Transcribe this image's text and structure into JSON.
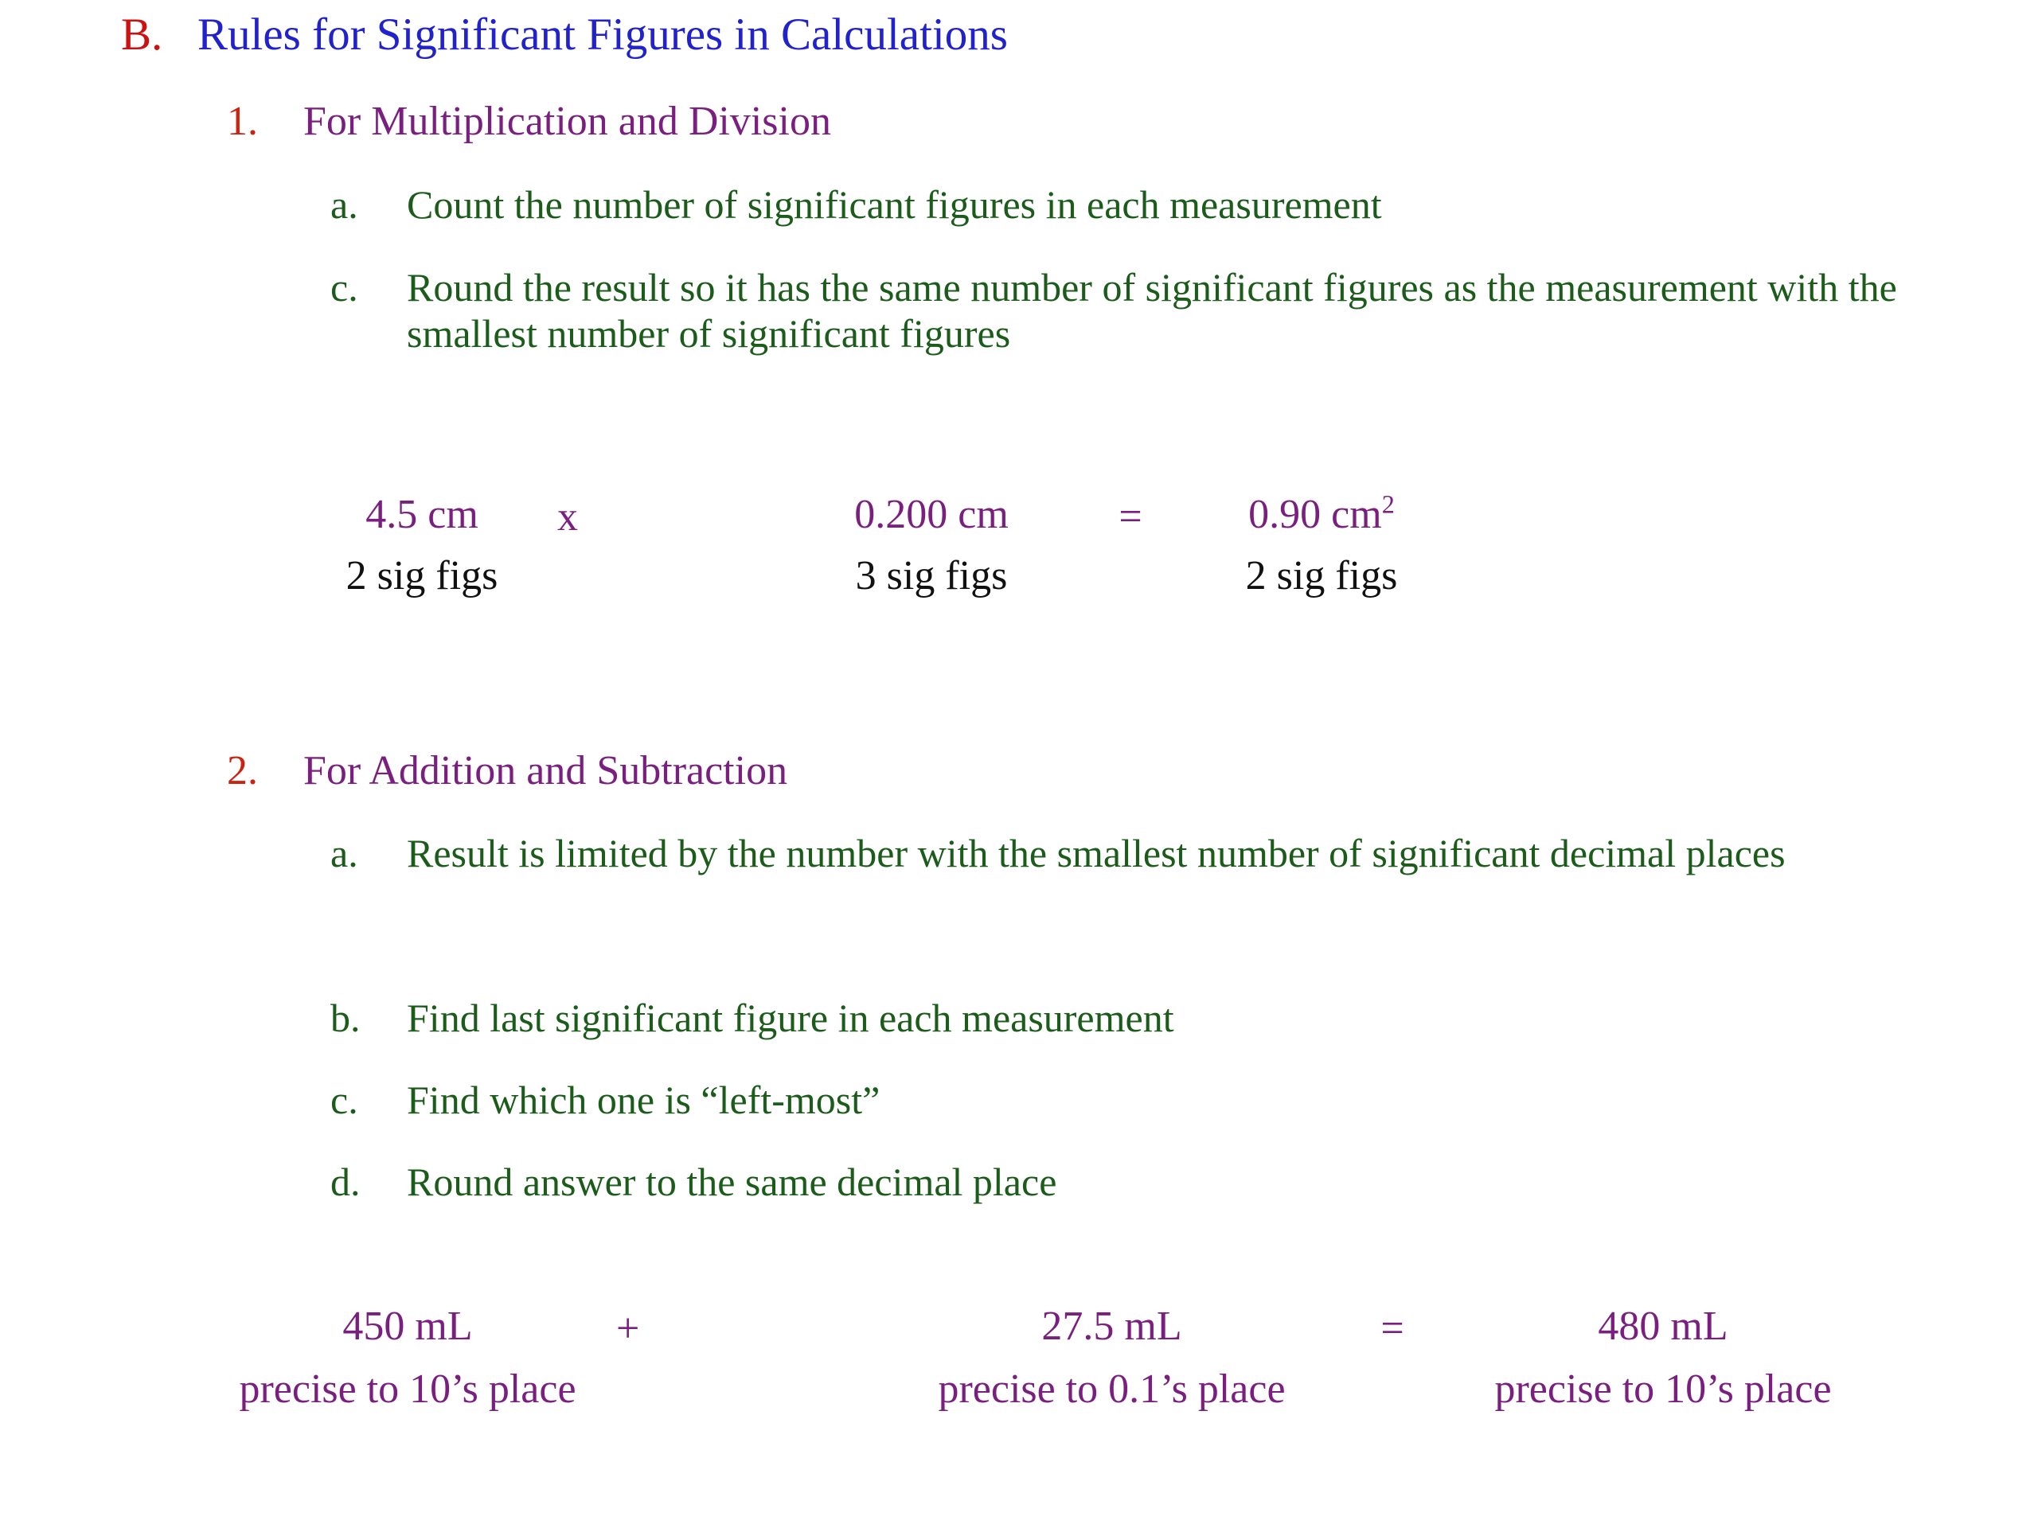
{
  "slide": {
    "background_color": "#ffffff",
    "colors": {
      "marker_red": "#cc1111",
      "heading_blue": "#2222cc",
      "subheading_purple": "#7a1f7f",
      "body_green": "#1b5c1b",
      "value_black": "#111111"
    }
  },
  "section": {
    "marker": "B.",
    "title": "Rules for Significant Figures in Calculations"
  },
  "rule1": {
    "marker": "1.",
    "title": "For Multiplication and Division",
    "items": [
      {
        "marker": "a.",
        "text": "Count the number of significant figures in each measurement"
      },
      {
        "marker": "c.",
        "text": "Round the result so it has the same number of significant figures as the measurement with the smallest number of significant figures"
      }
    ],
    "example": {
      "operand1_value": "4.5 cm",
      "operand1_note": "2 sig figs",
      "operator1": "x",
      "operand2_value": "0.200 cm",
      "operand2_note": "3 sig figs",
      "operator2": "=",
      "result_value": "0.90 cm",
      "result_exponent": "2",
      "result_note": "2 sig figs"
    }
  },
  "rule2": {
    "marker": "2.",
    "title": "For Addition and Subtraction",
    "items": [
      {
        "marker": "a.",
        "text": "Result is limited by the number with the smallest number of significant decimal places"
      },
      {
        "marker": "b.",
        "text": "Find last significant figure in each measurement"
      },
      {
        "marker": "c.",
        "text": "Find which one is “left-most”"
      },
      {
        "marker": "d.",
        "text": "Round answer to the same decimal place"
      }
    ],
    "example": {
      "operand1_value": "450 mL",
      "operand1_note": "precise to 10’s place",
      "operator1": "+",
      "operand2_value": "27.5 mL",
      "operand2_note": "precise to 0.1’s place",
      "operator2": "=",
      "result_value": "480 mL",
      "result_note": "precise to 10’s place"
    }
  }
}
